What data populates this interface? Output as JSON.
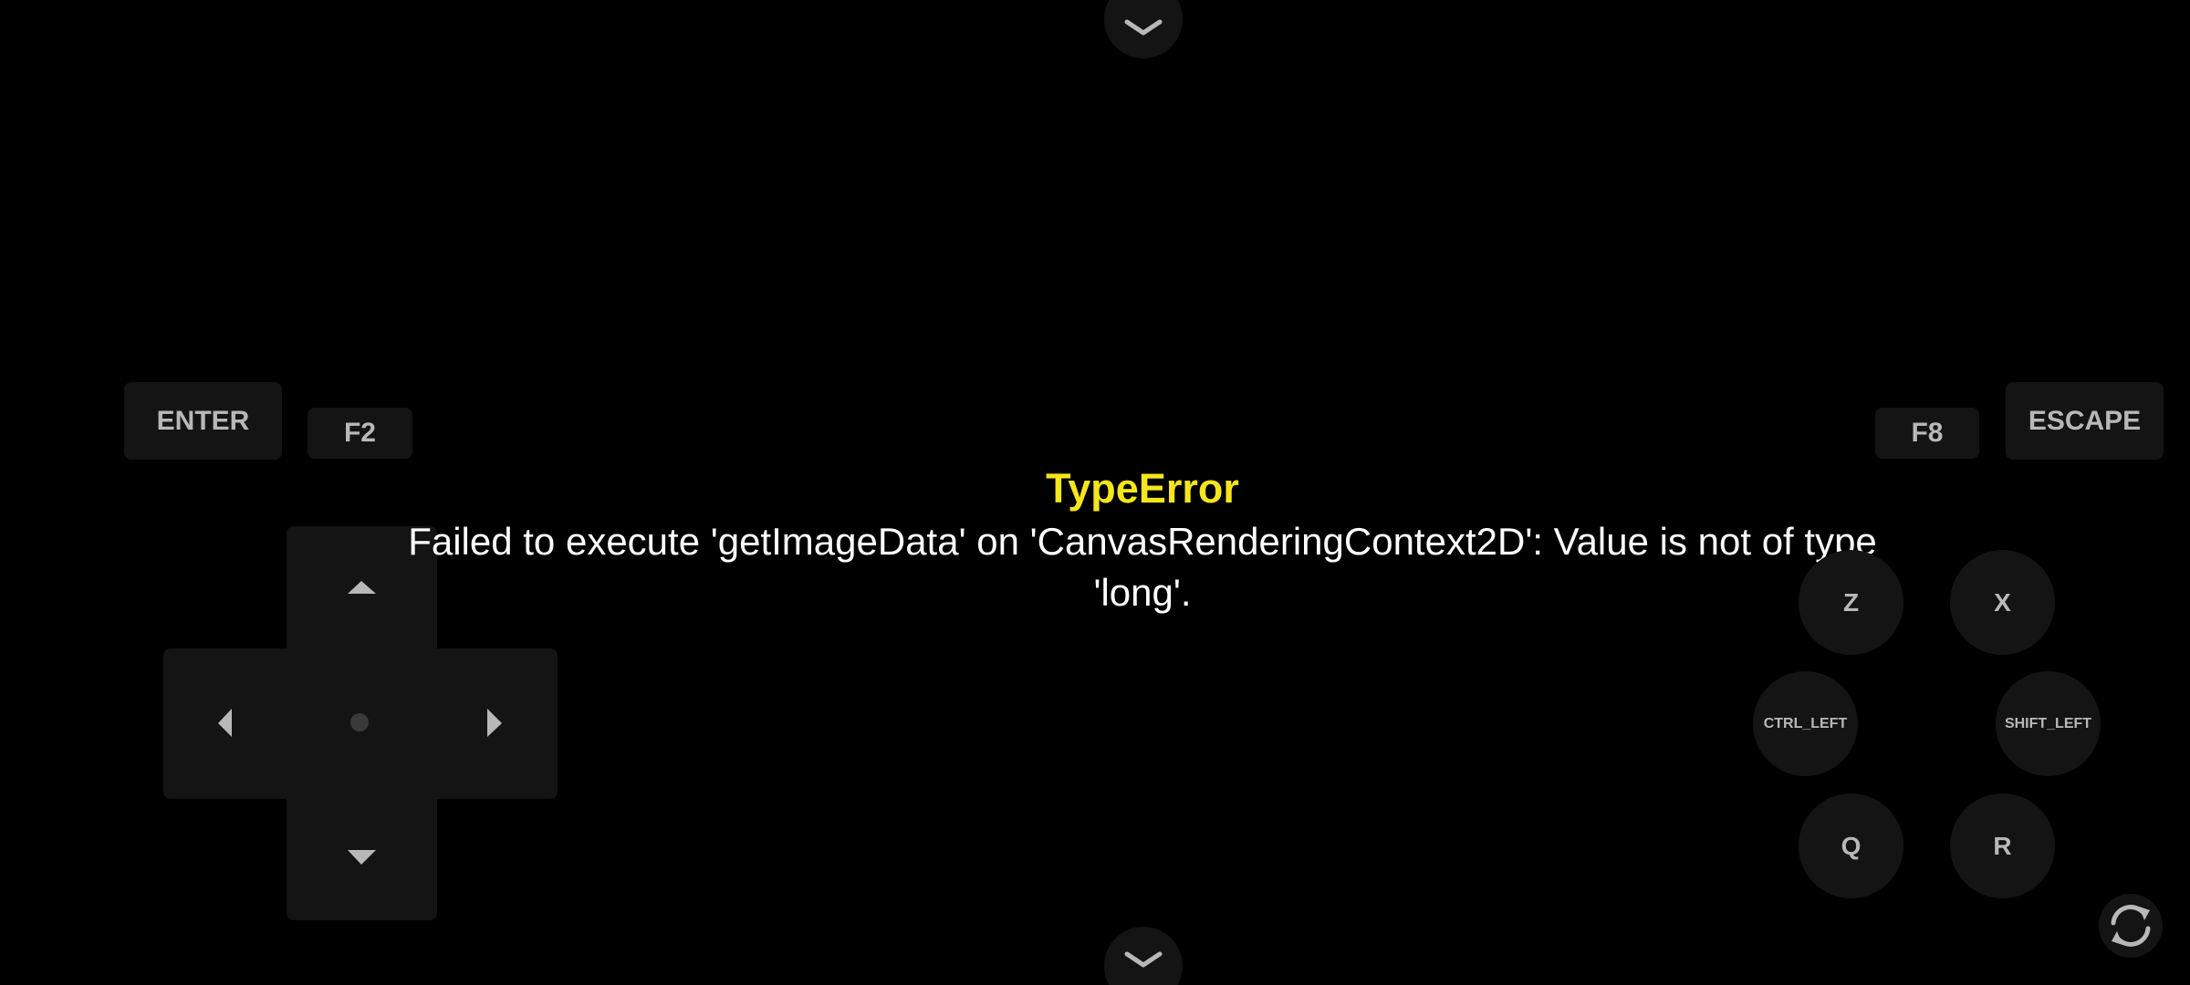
{
  "error": {
    "title": "TypeError",
    "message": "Failed to execute 'getImageData' on 'CanvasRenderingContext2D': Value is not of type 'long'."
  },
  "keys": {
    "enter": "ENTER",
    "f2": "F2",
    "f8": "F8",
    "escape": "ESCAPE",
    "z": "Z",
    "x": "X",
    "ctrl_left": "CTRL_LEFT",
    "shift_left": "SHIFT_LEFT",
    "q": "Q",
    "r": "R"
  },
  "icons": {
    "top_toggle": "chevron-down-icon",
    "bottom_toggle": "chevron-down-icon",
    "rotate": "rotate-icon",
    "dpad_up": "arrow-up-icon",
    "dpad_down": "arrow-down-icon",
    "dpad_left": "arrow-left-icon",
    "dpad_right": "arrow-right-icon"
  },
  "colors": {
    "background": "#000000",
    "button": "#141414",
    "button_text": "#b8b8b8",
    "error_title": "#f5e61b",
    "error_text": "#ffffff"
  }
}
